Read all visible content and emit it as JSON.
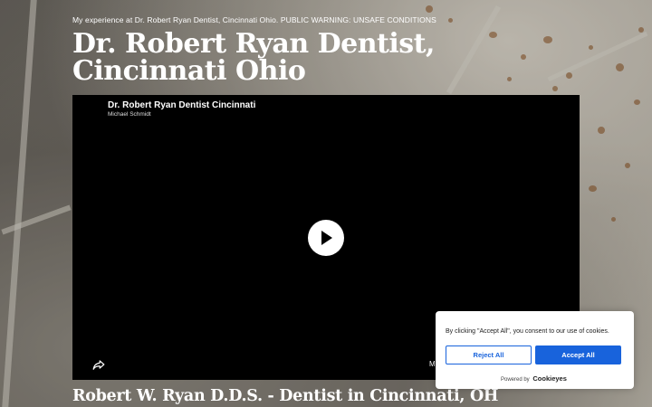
{
  "page": {
    "tagline": "My experience at Dr. Robert Ryan Dentist, Cincinnati Ohio. PUBLIC WARNING: UNSAFE CONDITIONS",
    "title": "Dr. Robert Ryan Dentist, Cincinnati Ohio",
    "subtitle": "Robert W. Ryan D.D.S. - Dentist in Cincinnati, OH"
  },
  "video": {
    "title": "Dr. Robert Ryan Dentist Cincinnati",
    "channel": "Michael Schmidt",
    "more_label": "M",
    "icons": {
      "play": "play-icon",
      "share": "share-icon"
    }
  },
  "cookie_banner": {
    "message": "By clicking \"Accept All\", you consent to our use of cookies.",
    "reject_label": "Reject All",
    "accept_label": "Accept All",
    "powered_by": "Powered by",
    "brand": "Cookieyes"
  },
  "colors": {
    "accent": "#1863dc",
    "video_bg": "#000000",
    "text_light": "#ffffff"
  }
}
